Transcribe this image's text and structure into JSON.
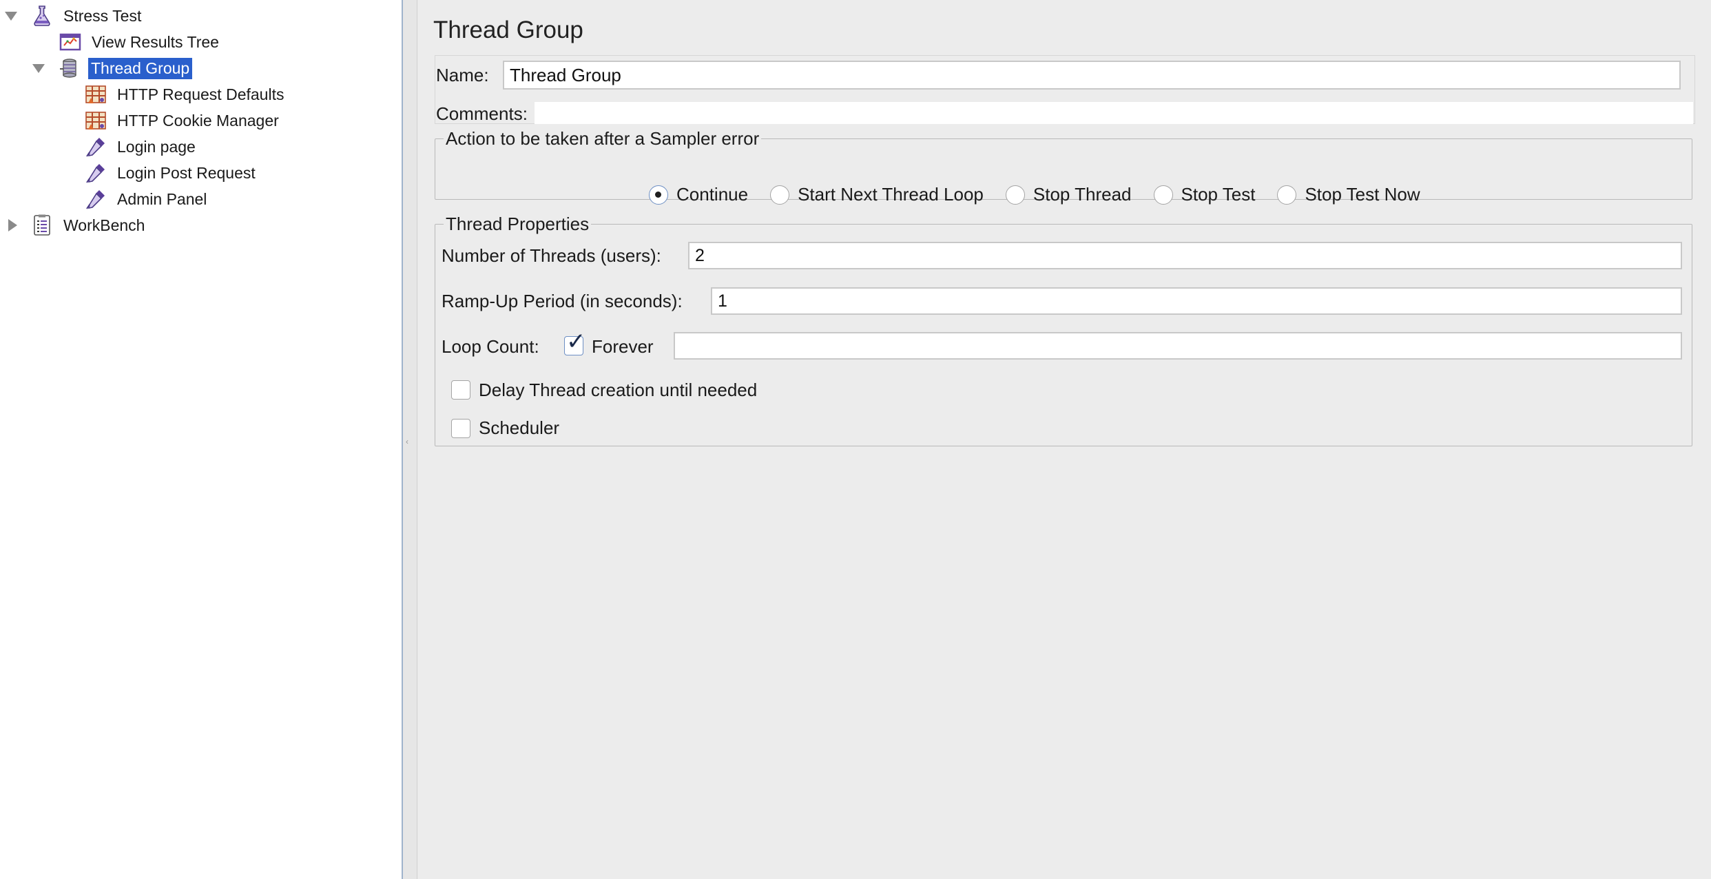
{
  "tree": {
    "items": [
      {
        "label": "Stress Test",
        "icon": "flask-icon",
        "expanded": true
      },
      {
        "label": "View Results Tree",
        "icon": "results-tree-icon"
      },
      {
        "label": "Thread Group",
        "icon": "thread-group-icon",
        "expanded": true,
        "selected": true
      },
      {
        "label": "HTTP Request Defaults",
        "icon": "config-element-icon"
      },
      {
        "label": "HTTP Cookie Manager",
        "icon": "config-element-icon"
      },
      {
        "label": "Login page",
        "icon": "sampler-pipette-icon"
      },
      {
        "label": "Login Post Request",
        "icon": "sampler-pipette-icon"
      },
      {
        "label": "Admin Panel",
        "icon": "sampler-pipette-icon"
      },
      {
        "label": "WorkBench",
        "icon": "workbench-icon",
        "expanded": false
      }
    ]
  },
  "panel": {
    "title": "Thread Group",
    "name_label": "Name:",
    "name_value": "Thread Group",
    "comments_label": "Comments:",
    "comments_value": ""
  },
  "sampler_error": {
    "legend": "Action to be taken after a Sampler error",
    "options": [
      "Continue",
      "Start Next Thread Loop",
      "Stop Thread",
      "Stop Test",
      "Stop Test Now"
    ],
    "selected": "Continue"
  },
  "thread_properties": {
    "legend": "Thread Properties",
    "threads_label": "Number of Threads (users):",
    "threads_value": "2",
    "rampup_label": "Ramp-Up Period (in seconds):",
    "rampup_value": "1",
    "loop_label": "Loop Count:",
    "forever_label": "Forever",
    "forever_checked": true,
    "loop_value": "",
    "delay_label": "Delay Thread creation until needed",
    "delay_checked": false,
    "scheduler_label": "Scheduler",
    "scheduler_checked": false
  },
  "colors": {
    "selection": "#2a5fcc",
    "panel_bg": "#ececec",
    "tree_bg": "#ffffff"
  }
}
